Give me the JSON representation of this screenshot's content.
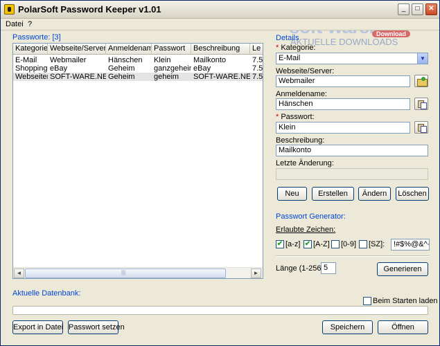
{
  "window": {
    "title": "PolarSoft Password Keeper v1.01",
    "minimize_glyph": "_",
    "maximize_glyph": "□",
    "close_glyph": "✕"
  },
  "menu": [
    "Datei",
    "?"
  ],
  "list": {
    "group_label": "Passworte: [3]",
    "columns": [
      "Kategorie",
      "Webseite/Server",
      "Anmeldename",
      "Passwort",
      "Beschreibung",
      "Le"
    ],
    "rows": [
      [
        "E-Mail",
        "Webmailer",
        "Hänschen",
        "Klein",
        "Mailkonto",
        "7.5"
      ],
      [
        "Shopping",
        "eBay",
        "Geheim",
        "ganzgeheim",
        "eBay",
        "7.5"
      ],
      [
        "Webseiten",
        "SOFT-WARE.NET",
        "Geheim",
        "geheim",
        "SOFT-WARE.NET",
        "7.5"
      ]
    ],
    "scroll_left": "◄",
    "scroll_right": "►"
  },
  "details": {
    "group_label": "Details",
    "kategorie_label": "Kategorie:",
    "kategorie_value": "E-Mail",
    "kategorie_arrow": "▼",
    "webseite_label": "Webseite/Server:",
    "webseite_value": "Webmailer",
    "anmeldename_label": "Anmeldename:",
    "anmeldename_value": "Hänschen",
    "passwort_label": "Passwort:",
    "passwort_value": "Klein",
    "beschreibung_label": "Beschreibung:",
    "beschreibung_value": "Mailkonto",
    "letzte_label": "Letzte Änderung:",
    "letzte_value": "",
    "required_marker": "*",
    "buttons": {
      "neu": "Neu",
      "erstellen": "Erstellen",
      "aendern": "Ändern",
      "loeschen": "Löschen"
    }
  },
  "generator": {
    "group_label": "Passwort Generator:",
    "erlaubte_label": "Erlaubte Zeichen:",
    "options": [
      {
        "label": "[a-z]",
        "checked": true
      },
      {
        "label": "[A-Z]",
        "checked": true
      },
      {
        "label": "[0-9]",
        "checked": false
      },
      {
        "label": "[SZ]:",
        "checked": false
      }
    ],
    "special_chars": "!#$%@&^-_",
    "laenge_label": "Länge (1-256):",
    "laenge_value": "5",
    "generieren": "Generieren",
    "check_glyph": "✔"
  },
  "database": {
    "label": "Aktuelle Datenbank:",
    "beim_starten_label": "Beim Starten laden",
    "beim_starten_checked": false
  },
  "bottom_buttons": {
    "export": "Export in Datei",
    "passwort_setzen": "Passwort setzen",
    "speichern": "Speichern",
    "oeffnen": "Öffnen"
  },
  "watermark": {
    "main": "soft-ware.net",
    "badge": "Download",
    "sub": "AKTUELLE DOWNLOADS"
  }
}
